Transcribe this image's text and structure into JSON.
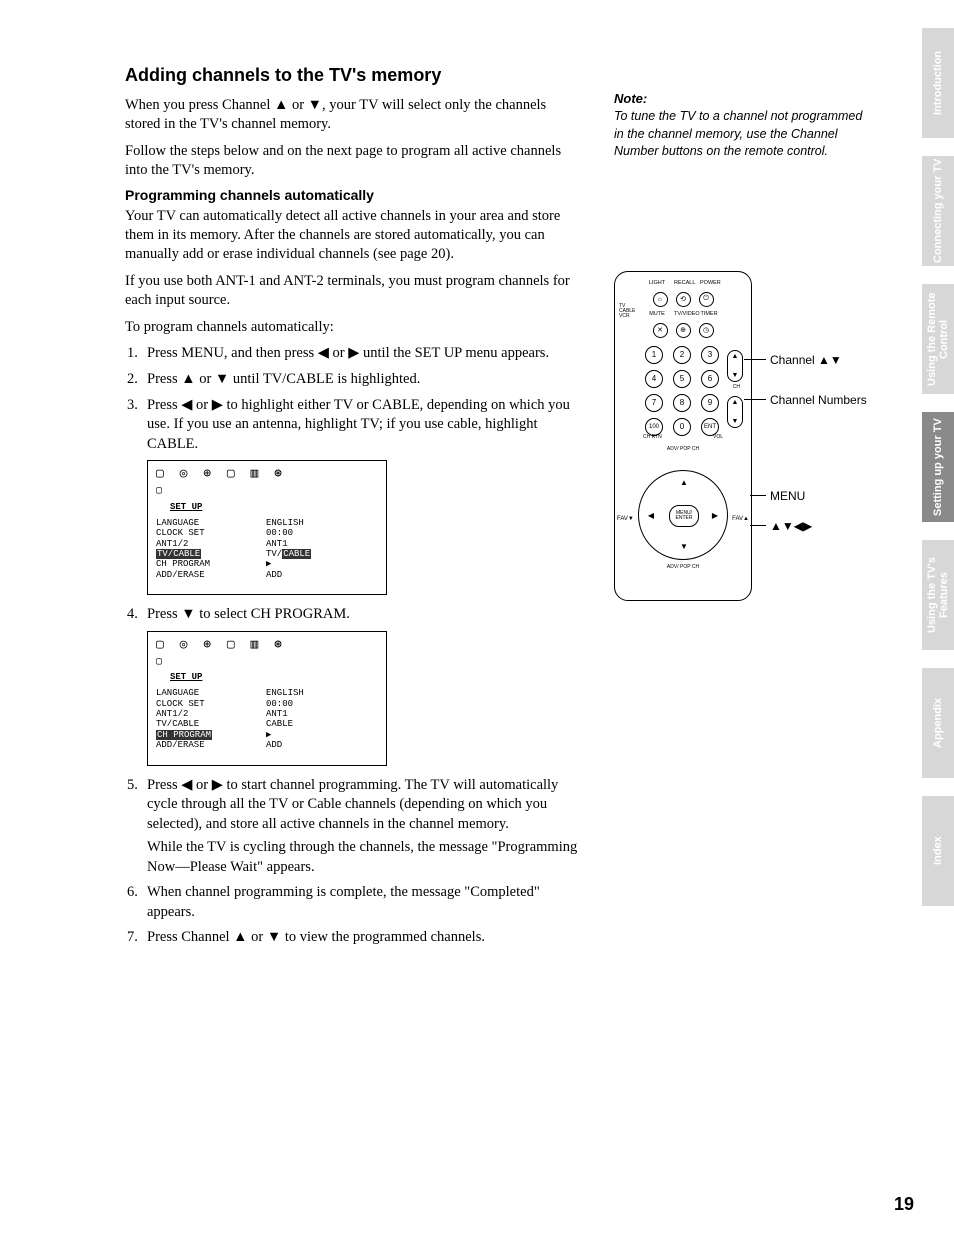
{
  "title": "Adding channels to the TV's memory",
  "intro1": "When you press Channel ▲ or ▼, your TV will select only the channels stored in the TV's channel memory.",
  "intro2": "Follow the steps below and on the next page to program all active channels into the TV's memory.",
  "sub_heading": "Programming channels automatically",
  "para1": "Your TV can automatically detect all active channels in your area and store them in its memory. After the channels are stored automatically, you can manually add or erase individual channels (see page 20).",
  "para2": "If you use both ANT-1 and ANT-2 terminals, you must program channels for each input source.",
  "para3": "To program channels automatically:",
  "steps": {
    "s1": "Press MENU, and then press ◀ or ▶ until the SET UP menu appears.",
    "s2": "Press ▲ or ▼ until TV/CABLE is highlighted.",
    "s3": "Press ◀ or ▶ to highlight either TV or CABLE, depending on which you use. If you use an antenna, highlight TV; if you use cable, highlight CABLE.",
    "s4": "Press ▼ to select CH PROGRAM.",
    "s5": "Press ◀ or ▶ to start channel programming. The TV will automatically cycle through all the TV or Cable channels (depending on which you selected), and store all active channels in the channel memory.",
    "s5b": "While the TV is cycling through the channels, the message \"Programming Now—Please Wait\" appears.",
    "s6": "When channel programming is complete, the message \"Completed\" appears.",
    "s7": "Press Channel ▲ or ▼ to view the programmed channels."
  },
  "note_head": "Note:",
  "note_body": "To tune the TV to a channel not programmed in the channel memory, use the Channel Number buttons on the remote control.",
  "osd": {
    "title": "SET UP",
    "rows": [
      {
        "l": "LANGUAGE",
        "r": "ENGLISH"
      },
      {
        "l": "CLOCK SET",
        "r": "00:00"
      },
      {
        "l": "ANT1/2",
        "r": "ANT1"
      },
      {
        "l": "TV/CABLE",
        "r": "TV/CABLE"
      },
      {
        "l": "CH PROGRAM",
        "r": "▶"
      },
      {
        "l": "ADD/ERASE",
        "r": "ADD"
      }
    ],
    "rows2": [
      {
        "l": "LANGUAGE",
        "r": "ENGLISH"
      },
      {
        "l": "CLOCK SET",
        "r": "00:00"
      },
      {
        "l": "ANT1/2",
        "r": "ANT1"
      },
      {
        "l": "TV/CABLE",
        "r": "CABLE"
      },
      {
        "l": "CH PROGRAM",
        "r": "▶"
      },
      {
        "l": "ADD/ERASE",
        "r": "ADD"
      }
    ]
  },
  "remote": {
    "top_labels": [
      "LIGHT",
      "RECALL",
      "POWER"
    ],
    "row2_labels": [
      "MUTE",
      "TV/VIDEO",
      "TIMER"
    ],
    "side_label": "TV\nCABLE\nVCR",
    "numbers": [
      "1",
      "2",
      "3",
      "4",
      "5",
      "6",
      "7",
      "8",
      "9",
      "100",
      "0",
      "ENT"
    ],
    "ch_label": "CH",
    "vol_label": "VOL",
    "chrtn": "CH RTN",
    "adv": "ADV/\nPOP CH",
    "menu": "MENU/\nENTER",
    "fav_l": "FAV▼",
    "fav_r": "FAV▲"
  },
  "callouts": {
    "c1": "Channel ▲▼",
    "c2": "Channel Numbers",
    "c3": "MENU",
    "c4": "▲▼◀▶"
  },
  "tabs": [
    "Introduction",
    "Connecting your TV",
    "Using the Remote Control",
    "Setting up your TV",
    "Using the TV's Features",
    "Appendix",
    "Index"
  ],
  "active_tab": 3,
  "page_number": "19"
}
